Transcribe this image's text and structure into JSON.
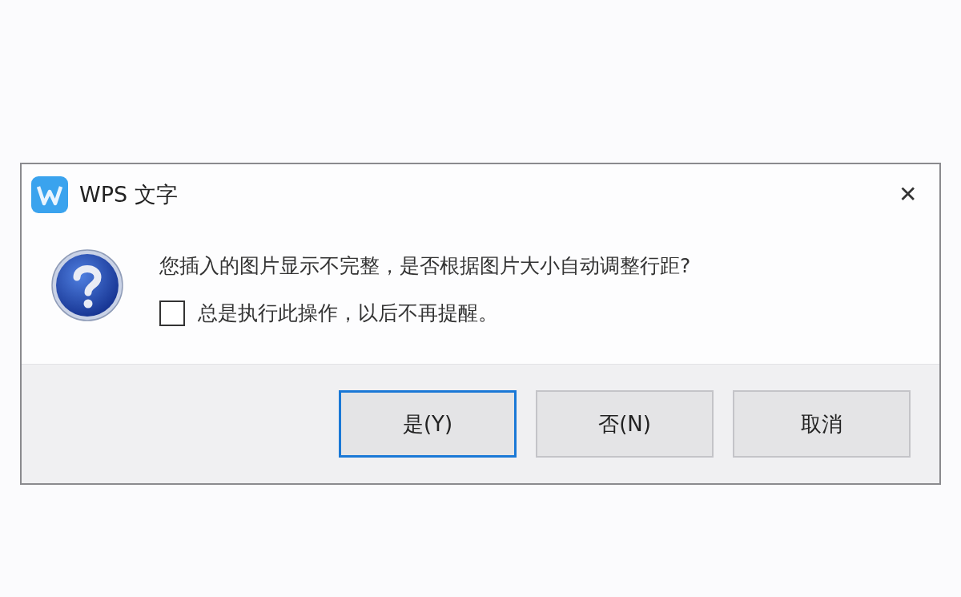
{
  "window": {
    "title": "WPS 文字",
    "close": "✕"
  },
  "message": "您插入的图片显示不完整，是否根据图片大小自动调整行距?",
  "checkbox": {
    "label": "总是执行此操作，以后不再提醒。",
    "checked": false
  },
  "buttons": [
    {
      "label": "是(Y)",
      "selected": true
    },
    {
      "label": "否(N)",
      "selected": false
    },
    {
      "label": "取消",
      "selected": false
    }
  ]
}
